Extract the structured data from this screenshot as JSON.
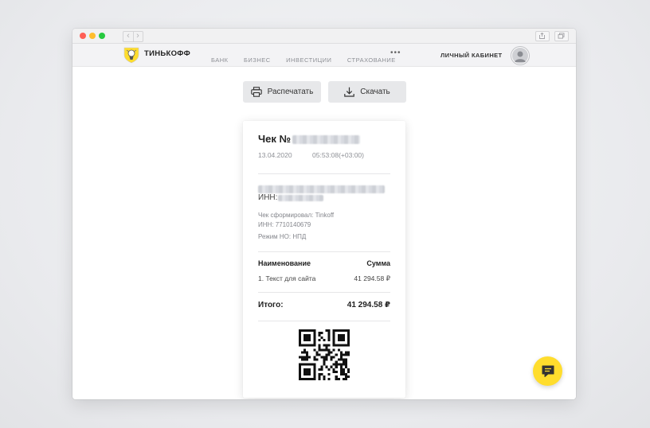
{
  "browser": {
    "back_icon": "chevron-left-icon",
    "forward_icon": "chevron-right-icon",
    "back_glyph": "‹",
    "forward_glyph": "›"
  },
  "site": {
    "brand": "ТИНЬКОФФ",
    "nav": [
      "БАНК",
      "БИЗНЕС",
      "ИНВЕСТИЦИИ",
      "СТРАХОВАНИЕ"
    ],
    "more": "•••",
    "cabinet": "ЛИЧНЫЙ КАБИНЕТ",
    "accent": "#ffdd2d"
  },
  "actions": {
    "print_label": "Распечатать",
    "download_label": "Скачать"
  },
  "receipt": {
    "title": "Чек №",
    "date": "13.04.2020",
    "time": "05:53:08(+03:00)",
    "inn_label": "ИНН:",
    "formed_by": "Чек сформировал: Tinkoff",
    "inn_line": "ИНН: 7710140679",
    "tax_mode": "Режим НО: НПД",
    "col_name": "Наименование",
    "col_sum": "Сумма",
    "items": [
      {
        "name": "1. Текст для сайта",
        "sum": "41 294.58 ₽"
      }
    ],
    "total_label": "Итого:",
    "total_value": "41 294.58 ₽"
  }
}
